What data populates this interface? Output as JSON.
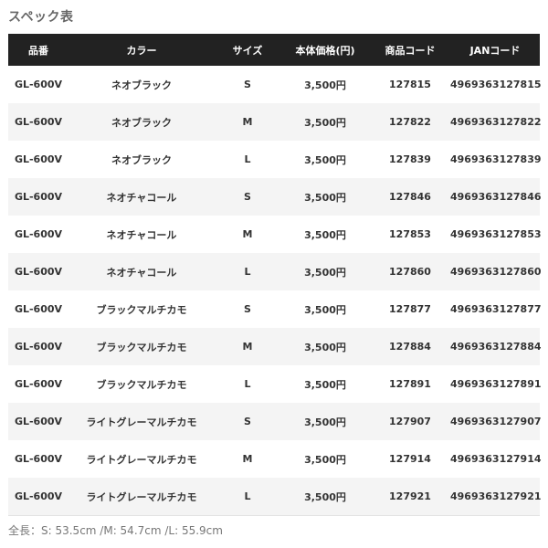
{
  "title": "スペック表",
  "table": {
    "headers": [
      "品番",
      "カラー",
      "サイズ",
      "本体価格(円)",
      "商品コード",
      "JANコード"
    ],
    "rows": [
      [
        "GL-600V",
        "ネオブラック",
        "S",
        "3,500円",
        "127815",
        "4969363127815"
      ],
      [
        "GL-600V",
        "ネオブラック",
        "M",
        "3,500円",
        "127822",
        "4969363127822"
      ],
      [
        "GL-600V",
        "ネオブラック",
        "L",
        "3,500円",
        "127839",
        "4969363127839"
      ],
      [
        "GL-600V",
        "ネオチャコール",
        "S",
        "3,500円",
        "127846",
        "4969363127846"
      ],
      [
        "GL-600V",
        "ネオチャコール",
        "M",
        "3,500円",
        "127853",
        "4969363127853"
      ],
      [
        "GL-600V",
        "ネオチャコール",
        "L",
        "3,500円",
        "127860",
        "4969363127860"
      ],
      [
        "GL-600V",
        "ブラックマルチカモ",
        "S",
        "3,500円",
        "127877",
        "4969363127877"
      ],
      [
        "GL-600V",
        "ブラックマルチカモ",
        "M",
        "3,500円",
        "127884",
        "4969363127884"
      ],
      [
        "GL-600V",
        "ブラックマルチカモ",
        "L",
        "3,500円",
        "127891",
        "4969363127891"
      ],
      [
        "GL-600V",
        "ライトグレーマルチカモ",
        "S",
        "3,500円",
        "127907",
        "4969363127907"
      ],
      [
        "GL-600V",
        "ライトグレーマルチカモ",
        "M",
        "3,500円",
        "127914",
        "4969363127914"
      ],
      [
        "GL-600V",
        "ライトグレーマルチカモ",
        "L",
        "3,500円",
        "127921",
        "4969363127921"
      ]
    ]
  },
  "footnote": "全長：S: 53.5cm /M: 54.7cm /L: 55.9cm",
  "colors": {
    "header_bg": "#222222",
    "header_text": "#ffffff",
    "stripe_bg": "#f4f4f4",
    "body_text": "#333333"
  }
}
